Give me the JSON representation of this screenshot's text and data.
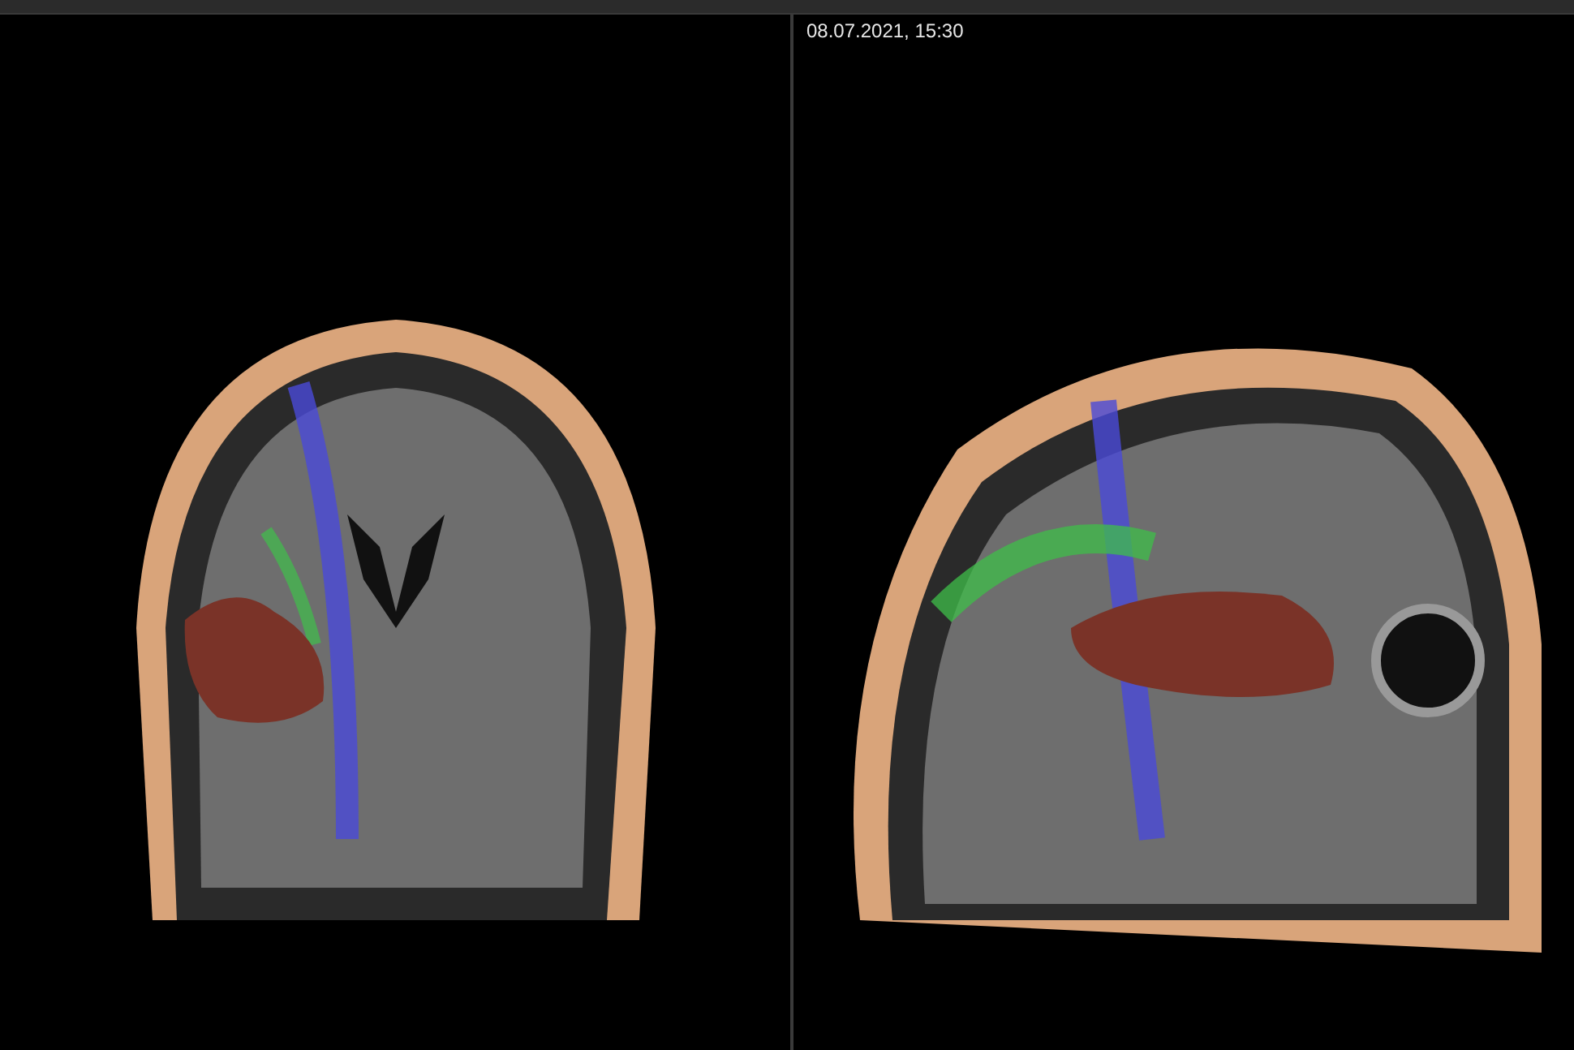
{
  "viewports": [
    {
      "kind": "coronal"
    },
    {
      "kind": "sagittal",
      "timestamp": "08.07.2021, 15:30"
    }
  ]
}
